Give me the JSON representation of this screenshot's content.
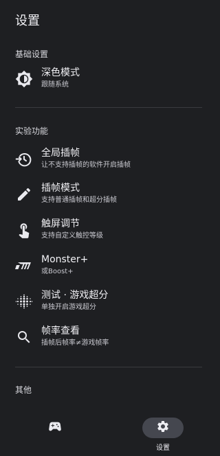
{
  "header": {
    "title": "设置"
  },
  "sections": {
    "basic": {
      "label": "基础设置",
      "dark_mode": {
        "title": "深色模式",
        "subtitle": "跟随系统",
        "icon": "brightness-auto-icon"
      }
    },
    "experimental": {
      "label": "实验功能",
      "items": [
        {
          "title": "全局插帧",
          "subtitle": "让不支持插帧的软件开启插帧",
          "icon": "restore-clock-icon"
        },
        {
          "title": "插帧模式",
          "subtitle": "支持普通插帧和超分插帧",
          "icon": "pencil-icon"
        },
        {
          "title": "触屏调节",
          "subtitle": "支持自定义触控等级",
          "icon": "touch-hand-icon"
        },
        {
          "title": "Monster+",
          "subtitle": "或Boost+",
          "icon": "monster-logo-icon"
        },
        {
          "title": "测试 · 游戏超分",
          "subtitle": "单独开启游戏超分",
          "icon": "blur-dots-icon"
        },
        {
          "title": "帧率查看",
          "subtitle": "插帧后帧率≠游戏帧率",
          "icon": "search-icon"
        }
      ]
    },
    "other": {
      "label": "其他"
    }
  },
  "bottom_nav": {
    "games": {
      "label": "",
      "icon": "gamepad-icon"
    },
    "settings": {
      "label": "设置",
      "icon": "gear-icon",
      "selected": true
    }
  },
  "colors": {
    "background": "#1e1f22",
    "divider": "#3a3b3f",
    "nav_pill_active": "#45474f",
    "text_primary": "#f1f1f5",
    "text_secondary": "#c9c9d0"
  }
}
